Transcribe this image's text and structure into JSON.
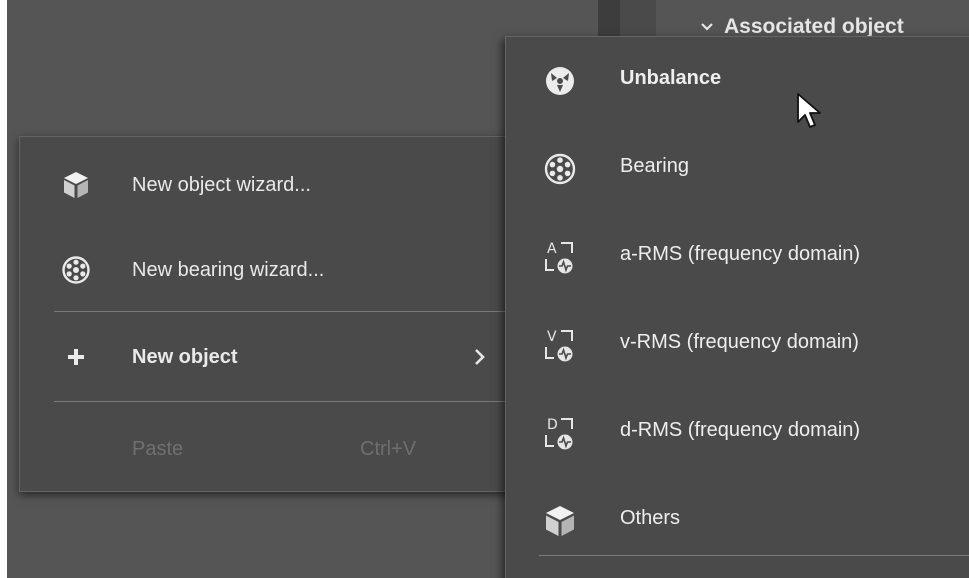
{
  "header": {
    "associated_object_label": "Associated object"
  },
  "context_menu": {
    "items": [
      {
        "label": "New object wizard...",
        "icon": "cube-icon"
      },
      {
        "label": "New bearing wizard...",
        "icon": "bearing-icon"
      },
      {
        "label": "New object",
        "icon": "plus-icon",
        "has_submenu": true
      },
      {
        "label": "Paste",
        "shortcut": "Ctrl+V",
        "icon": "",
        "disabled": true
      }
    ]
  },
  "submenu": {
    "items": [
      {
        "label": "Unbalance",
        "icon": "unbalance-icon",
        "hovered": true
      },
      {
        "label": "Bearing",
        "icon": "bearing-icon"
      },
      {
        "label": "a-RMS (frequency domain)",
        "icon": "a-rms-icon",
        "icon_letter": "A"
      },
      {
        "label": "v-RMS (frequency domain)",
        "icon": "v-rms-icon",
        "icon_letter": "V"
      },
      {
        "label": "d-RMS (frequency domain)",
        "icon": "d-rms-icon",
        "icon_letter": "D"
      },
      {
        "label": "Others",
        "icon": "cube-icon"
      }
    ]
  },
  "colors": {
    "background": "#555555",
    "menu_background": "#4a4a4a",
    "text": "#e9e9e9",
    "disabled_text": "#707070",
    "icon": "#e6e6e6"
  }
}
